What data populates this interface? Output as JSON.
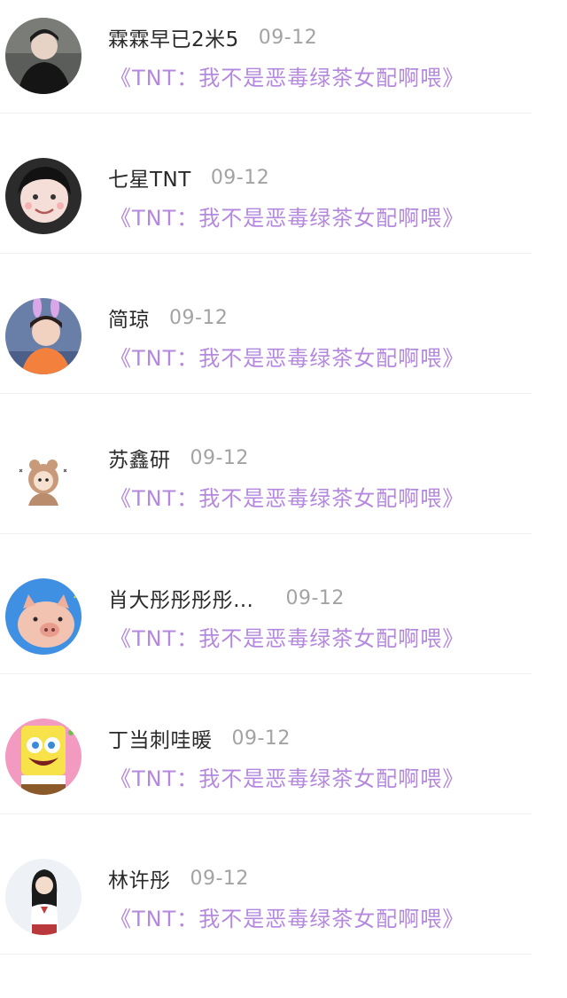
{
  "items": [
    {
      "name": "霖霖早已2米5",
      "date": "09-12",
      "title": "《TNT：我不是恶毒绿茶女配啊喂》"
    },
    {
      "name": "七星TNT",
      "date": "09-12",
      "title": "《TNT：我不是恶毒绿茶女配啊喂》"
    },
    {
      "name": "简琼",
      "date": "09-12",
      "title": "《TNT：我不是恶毒绿茶女配啊喂》"
    },
    {
      "name": "苏鑫研",
      "date": "09-12",
      "title": "《TNT：我不是恶毒绿茶女配啊喂》"
    },
    {
      "name": "肖大彤彤彤彤…",
      "date": "09-12",
      "title": "《TNT：我不是恶毒绿茶女配啊喂》"
    },
    {
      "name": "丁当刺哇暖",
      "date": "09-12",
      "title": "《TNT：我不是恶毒绿茶女配啊喂》"
    },
    {
      "name": "林许彤",
      "date": "09-12",
      "title": "《TNT：我不是恶毒绿茶女配啊喂》"
    }
  ],
  "colors": {
    "title": "#b488de",
    "name": "#2a2a2a",
    "date": "#a3a3a3"
  }
}
